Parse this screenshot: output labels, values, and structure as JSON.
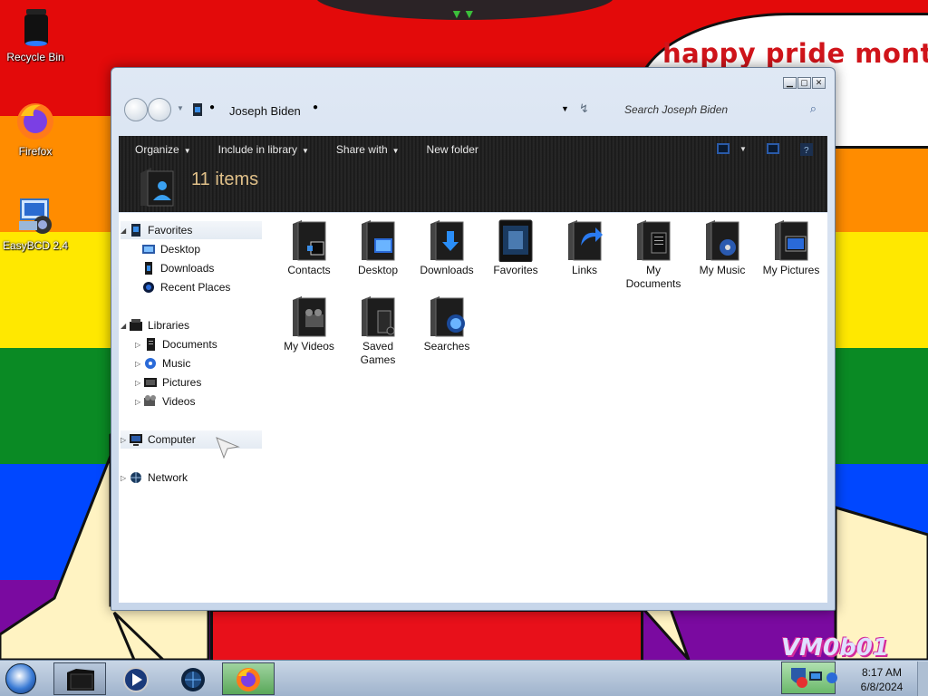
{
  "desktop": {
    "banner_text": "happy pride month",
    "watermark": "VM0b01",
    "icons": [
      {
        "label": "Recycle Bin",
        "icon": "recycle-bin-icon"
      },
      {
        "label": "Firefox",
        "icon": "firefox-icon"
      },
      {
        "label": "EasyBCD 2.4",
        "icon": "easybcd-icon"
      }
    ],
    "stripe_colors": [
      "#e30a0a",
      "#ff8c00",
      "#ffe800",
      "#0a8a24",
      "#0047ff",
      "#7a0aa0"
    ]
  },
  "window": {
    "controls": [
      "minimize",
      "maximize",
      "close"
    ],
    "address": {
      "path": "Joseph Biden"
    },
    "search": {
      "placeholder": "Search Joseph Biden"
    },
    "commands": [
      {
        "label": "Organize",
        "dropdown": true
      },
      {
        "label": "Include in library",
        "dropdown": true
      },
      {
        "label": "Share with",
        "dropdown": true
      },
      {
        "label": "New folder",
        "dropdown": false
      }
    ],
    "header": {
      "count_text": "11 items"
    },
    "nav": {
      "favorites": {
        "label": "Favorites",
        "items": [
          "Desktop",
          "Downloads",
          "Recent Places"
        ]
      },
      "libraries": {
        "label": "Libraries",
        "items": [
          "Documents",
          "Music",
          "Pictures",
          "Videos"
        ]
      },
      "computer": {
        "label": "Computer"
      },
      "network": {
        "label": "Network"
      }
    },
    "files": [
      {
        "label": "Contacts",
        "icon": "contacts-folder-icon"
      },
      {
        "label": "Desktop",
        "icon": "desktop-folder-icon"
      },
      {
        "label": "Downloads",
        "icon": "downloads-folder-icon"
      },
      {
        "label": "Favorites",
        "icon": "favorites-folder-icon"
      },
      {
        "label": "Links",
        "icon": "links-folder-icon"
      },
      {
        "label": "My Documents",
        "icon": "documents-folder-icon"
      },
      {
        "label": "My Music",
        "icon": "music-folder-icon"
      },
      {
        "label": "My Pictures",
        "icon": "pictures-folder-icon"
      },
      {
        "label": "My Videos",
        "icon": "videos-folder-icon"
      },
      {
        "label": "Saved Games",
        "icon": "saved-games-folder-icon"
      },
      {
        "label": "Searches",
        "icon": "searches-folder-icon"
      }
    ]
  },
  "taskbar": {
    "time": "8:17 AM",
    "date": "6/8/2024",
    "pinned": [
      "explorer-icon",
      "media-player-icon",
      "network-globe-icon",
      "firefox-icon"
    ]
  }
}
